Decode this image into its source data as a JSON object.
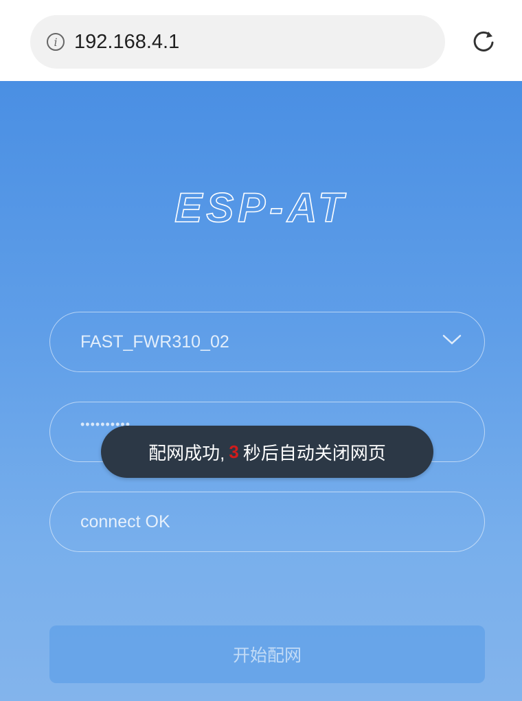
{
  "browser": {
    "url": "192.168.4.1",
    "info_icon": "info-icon",
    "reload_icon": "reload-icon"
  },
  "logo": {
    "text": "ESP-AT"
  },
  "form": {
    "ssid": "FAST_FWR310_02",
    "password_mask": "••••••••••",
    "status": "connect OK",
    "start_button": "开始配网"
  },
  "toast": {
    "prefix": "配网成功,",
    "countdown": "3",
    "suffix": "秒后自动关闭网页"
  },
  "colors": {
    "bg_top": "#4a8fe3",
    "bg_bottom": "#83b4ec",
    "toast_bg": "#2c3846",
    "countdown": "#d01c1c"
  }
}
